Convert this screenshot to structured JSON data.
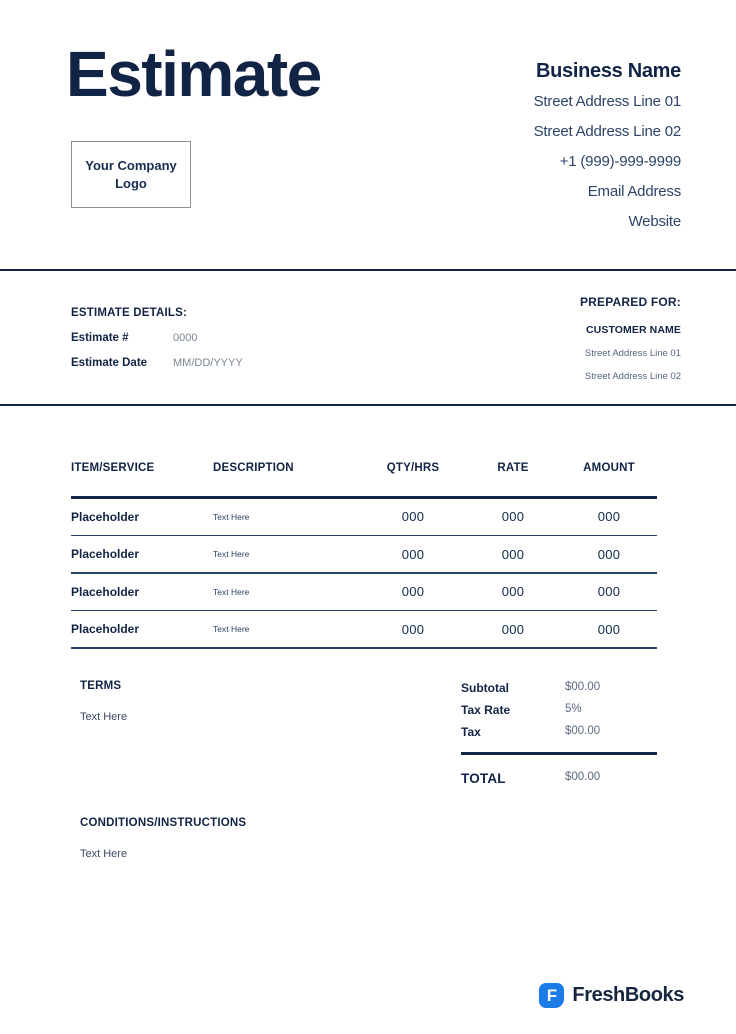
{
  "document": {
    "title": "Estimate",
    "logo_placeholder": "Your Company\nLogo",
    "logo_placeholder_line1": "Your Company",
    "logo_placeholder_line2": "Logo"
  },
  "business": {
    "name": "Business Name",
    "lines": [
      "Street Address Line 01",
      "Street Address Line 02",
      "+1 (999)-999-9999",
      "Email Address",
      "Website"
    ]
  },
  "estimate_details": {
    "section_title": "ESTIMATE DETAILS:",
    "rows": [
      {
        "label": "Estimate #",
        "value": "0000"
      },
      {
        "label": "Estimate Date",
        "value": "MM/DD/YYYY"
      }
    ]
  },
  "prepared_for": {
    "title": "PREPARED FOR:",
    "customer_name": "CUSTOMER NAME",
    "lines": [
      "Street Address Line 01",
      "Street Address Line 02"
    ]
  },
  "line_items_table": {
    "columns": [
      "ITEM/SERVICE",
      "DESCRIPTION",
      "QTY/HRS",
      "RATE",
      "AMOUNT"
    ],
    "rows": [
      {
        "item": "Placeholder",
        "description": "Text Here",
        "qty": "000",
        "rate": "000",
        "amount": "000"
      },
      {
        "item": "Placeholder",
        "description": "Text Here",
        "qty": "000",
        "rate": "000",
        "amount": "000"
      },
      {
        "item": "Placeholder",
        "description": "Text Here",
        "qty": "000",
        "rate": "000",
        "amount": "000"
      },
      {
        "item": "Placeholder",
        "description": "Text Here",
        "qty": "000",
        "rate": "000",
        "amount": "000"
      }
    ]
  },
  "terms": {
    "title": "TERMS",
    "body": "Text Here"
  },
  "conditions": {
    "title": "CONDITIONS/INSTRUCTIONS",
    "body": "Text Here"
  },
  "totals": {
    "rows": [
      {
        "label": "Subtotal",
        "value": "$00.00"
      },
      {
        "label": "Tax Rate",
        "value": "5%"
      },
      {
        "label": "Tax",
        "value": "$00.00"
      }
    ],
    "grand_total": {
      "label": "TOTAL",
      "value": "$00.00"
    }
  },
  "footer": {
    "brand_mark_letter": "F",
    "brand_name": "FreshBooks"
  },
  "colors": {
    "navy": "#122445",
    "rule": "#12284b",
    "muted": "#5a6a7e",
    "brand_blue": "#1b7ce8",
    "logo_border": "#8c8f96"
  }
}
